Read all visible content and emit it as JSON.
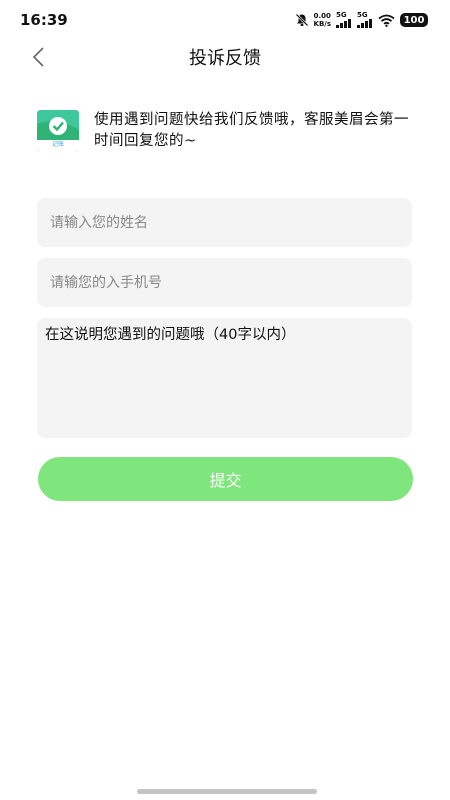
{
  "status_bar": {
    "time": "16:39",
    "net_speed_value": "0.00",
    "net_speed_unit": "KB/s",
    "signal1_label": "5G",
    "signal2_label": "5G",
    "battery": "100",
    "icons": [
      "bell-mute-icon",
      "signal-icon",
      "signal-icon",
      "wifi-icon",
      "battery-icon"
    ]
  },
  "nav": {
    "title": "投诉反馈",
    "back_icon": "chevron-left-icon"
  },
  "intro": {
    "text": "使用遇到问题快给我们反馈哦，客服美眉会第一时间回复您的~",
    "logo_label": "记账",
    "logo_color": "#3aa3e0",
    "logo_accent": "#33c46a"
  },
  "form": {
    "name_placeholder": "请输入您的姓名",
    "phone_placeholder": "请输您的入手机号",
    "description_placeholder": "在这说明您遇到的问题哦（40字以内）",
    "submit_label": "提交"
  },
  "colors": {
    "accent": "#7ee67c",
    "field_bg": "#f4f4f4"
  }
}
